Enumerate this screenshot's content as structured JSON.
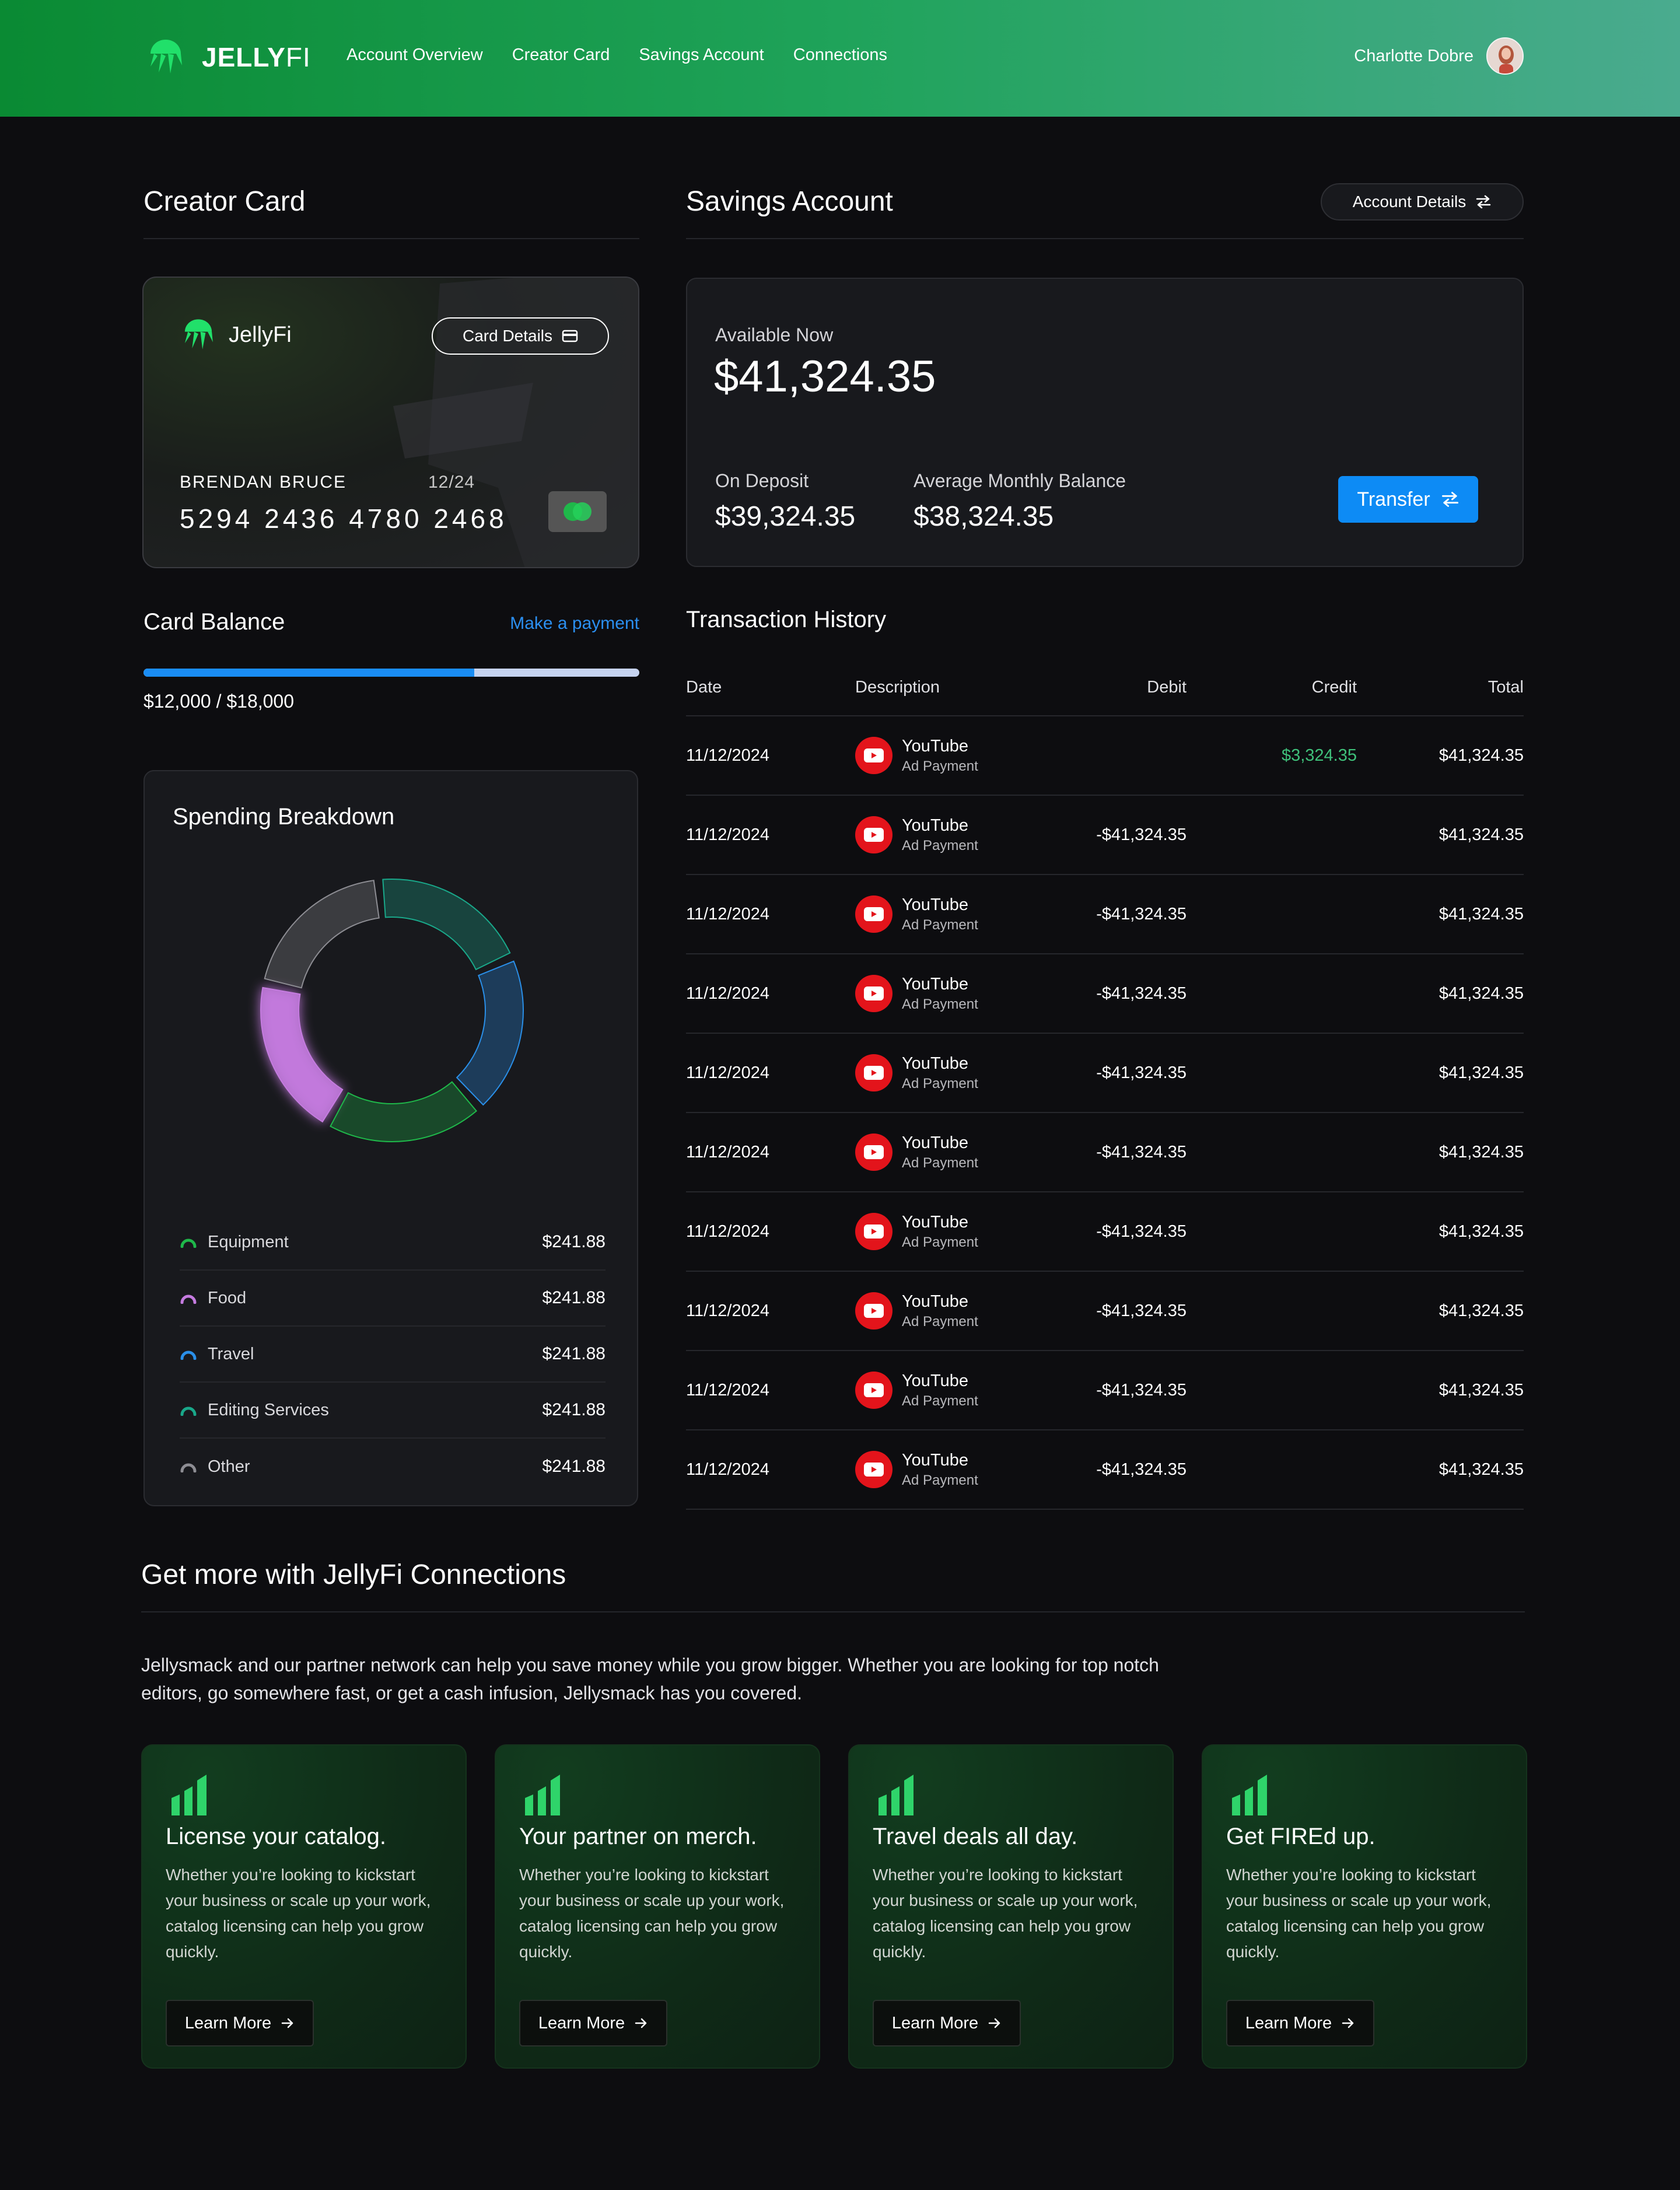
{
  "header": {
    "brand_bold": "JELLY",
    "brand_light": "FI",
    "nav": [
      "Account Overview",
      "Creator Card",
      "Savings Account",
      "Connections"
    ],
    "user_name": "Charlotte Dobre"
  },
  "creator_card": {
    "title": "Creator Card",
    "card_brand": "JellyFi",
    "card_details_label": "Card Details",
    "holder": "BRENDAN BRUCE",
    "expiry": "12/24",
    "number": "5294 2436 4780 2468",
    "balance_title": "Card Balance",
    "make_payment": "Make a payment",
    "balance_text": "$12,000 / $18,000",
    "balance_used": 12000,
    "balance_limit": 18000
  },
  "spending": {
    "title": "Spending Breakdown",
    "items": [
      {
        "label": "Equipment",
        "value": "$241.88",
        "color": "#1fb84a"
      },
      {
        "label": "Food",
        "value": "$241.88",
        "color": "#c57be0"
      },
      {
        "label": "Travel",
        "value": "$241.88",
        "color": "#2a8fe8"
      },
      {
        "label": "Editing Services",
        "value": "$241.88",
        "color": "#19a88a"
      },
      {
        "label": "Other",
        "value": "$241.88",
        "color": "#8d8d93"
      }
    ]
  },
  "savings": {
    "title": "Savings Account",
    "account_details_label": "Account Details",
    "available_label": "Available Now",
    "available_value": "$41,324.35",
    "deposit_label": "On Deposit",
    "deposit_value": "$39,324.35",
    "avg_label": "Average Monthly Balance",
    "avg_value": "$38,324.35",
    "transfer_label": "Transfer"
  },
  "transactions": {
    "title": "Transaction History",
    "columns": [
      "Date",
      "Description",
      "Debit",
      "Credit",
      "Total"
    ],
    "rows": [
      {
        "date": "11/12/2024",
        "name": "YouTube",
        "sub": "Ad Payment",
        "debit": "",
        "credit": "$3,324.35",
        "total": "$41,324.35"
      },
      {
        "date": "11/12/2024",
        "name": "YouTube",
        "sub": "Ad Payment",
        "debit": "-$41,324.35",
        "credit": "",
        "total": "$41,324.35"
      },
      {
        "date": "11/12/2024",
        "name": "YouTube",
        "sub": "Ad Payment",
        "debit": "-$41,324.35",
        "credit": "",
        "total": "$41,324.35"
      },
      {
        "date": "11/12/2024",
        "name": "YouTube",
        "sub": "Ad Payment",
        "debit": "-$41,324.35",
        "credit": "",
        "total": "$41,324.35"
      },
      {
        "date": "11/12/2024",
        "name": "YouTube",
        "sub": "Ad Payment",
        "debit": "-$41,324.35",
        "credit": "",
        "total": "$41,324.35"
      },
      {
        "date": "11/12/2024",
        "name": "YouTube",
        "sub": "Ad Payment",
        "debit": "-$41,324.35",
        "credit": "",
        "total": "$41,324.35"
      },
      {
        "date": "11/12/2024",
        "name": "YouTube",
        "sub": "Ad Payment",
        "debit": "-$41,324.35",
        "credit": "",
        "total": "$41,324.35"
      },
      {
        "date": "11/12/2024",
        "name": "YouTube",
        "sub": "Ad Payment",
        "debit": "-$41,324.35",
        "credit": "",
        "total": "$41,324.35"
      },
      {
        "date": "11/12/2024",
        "name": "YouTube",
        "sub": "Ad Payment",
        "debit": "-$41,324.35",
        "credit": "",
        "total": "$41,324.35"
      },
      {
        "date": "11/12/2024",
        "name": "YouTube",
        "sub": "Ad Payment",
        "debit": "-$41,324.35",
        "credit": "",
        "total": "$41,324.35"
      }
    ]
  },
  "connections": {
    "title": "Get more with JellyFi Connections",
    "text": "Jellysmack and our partner network can help you save money while you grow bigger. Whether you are looking for top notch editors, go somewhere fast, or get a cash infusion, Jellysmack has you covered.",
    "cards": [
      {
        "title": "License your catalog.",
        "body": "Whether you’re looking to kickstart your business or scale up your work, catalog licensing can help you grow quickly.",
        "button": "Learn More"
      },
      {
        "title": "Your partner on merch.",
        "body": "Whether you’re looking to kickstart your business or scale up your work, catalog licensing can help you grow quickly.",
        "button": "Learn More"
      },
      {
        "title": "Travel deals all day.",
        "body": "Whether you’re looking to kickstart your business or scale up your work, catalog licensing can help you grow quickly.",
        "button": "Learn More"
      },
      {
        "title": "Get FIREd up.",
        "body": "Whether you’re looking to kickstart your business or scale up your work, catalog licensing can help you grow quickly.",
        "button": "Learn More"
      }
    ]
  },
  "icons": {
    "logo": "jellyfish-logo-icon",
    "card_details": "credit-card-icon",
    "account_details": "swap-arrows-icon",
    "transfer": "swap-arrows-icon",
    "youtube": "youtube-icon",
    "promo": "bar-chart-icon",
    "learn_more": "arrow-right-icon"
  }
}
